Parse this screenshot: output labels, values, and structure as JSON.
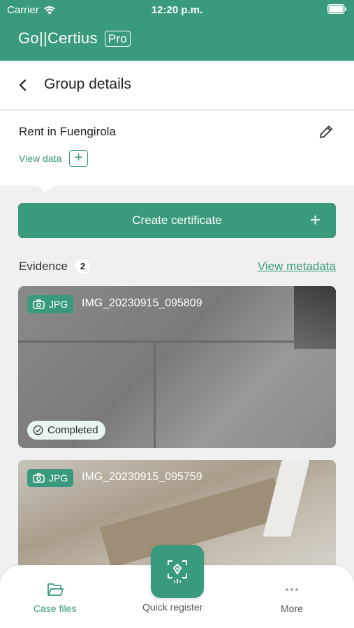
{
  "status_bar": {
    "carrier": "Carrier",
    "time": "12:20 p.m."
  },
  "brand": {
    "name": "Go||Certius",
    "badge": "Pro"
  },
  "header": {
    "title": "Group details"
  },
  "group": {
    "name": "Rent in Fuengirola",
    "view_data_label": "View data",
    "add_symbol": "+"
  },
  "actions": {
    "create_certificate_label": "Create certificate",
    "create_symbol": "+"
  },
  "evidence": {
    "label": "Evidence",
    "count": "2",
    "view_metadata_label": "View metadata",
    "items": [
      {
        "type": "JPG",
        "filename": "IMG_20230915_095809",
        "status": "Completed"
      },
      {
        "type": "JPG",
        "filename": "IMG_20230915_095759"
      }
    ]
  },
  "tabbar": {
    "case_files": "Case files",
    "quick_register": "Quick register",
    "more": "More"
  },
  "colors": {
    "accent": "#3a9a7d",
    "background": "#f0f0f0"
  }
}
